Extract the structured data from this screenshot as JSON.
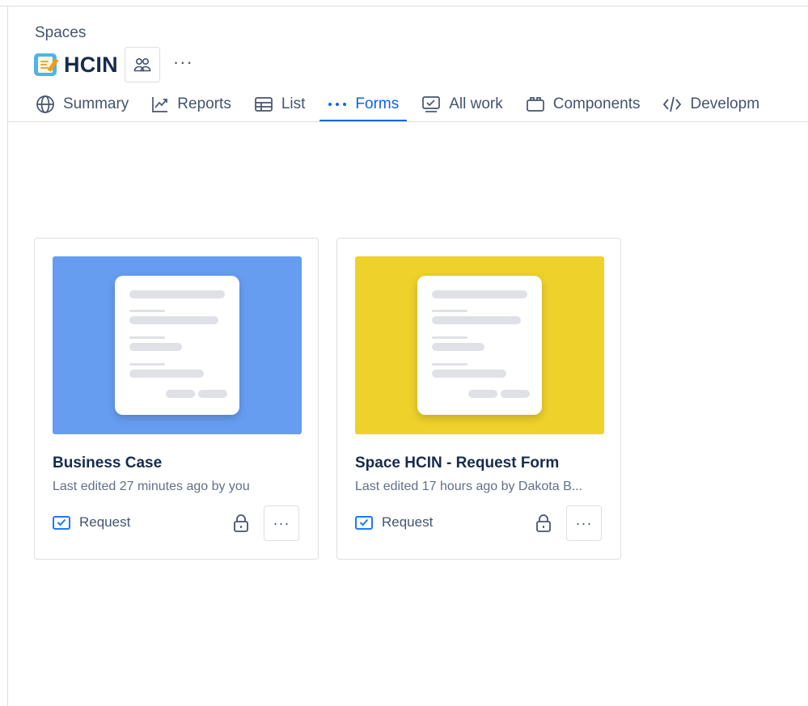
{
  "breadcrumb": "Spaces",
  "space": {
    "title": "HCIN",
    "icon": "memo-icon",
    "more_label": "···"
  },
  "tabs": [
    {
      "label": "Summary",
      "icon": "globe-icon",
      "active": false
    },
    {
      "label": "Reports",
      "icon": "line-chart-icon",
      "active": false
    },
    {
      "label": "List",
      "icon": "table-icon",
      "active": false
    },
    {
      "label": "Forms",
      "icon": "dots-icon",
      "active": true
    },
    {
      "label": "All work",
      "icon": "stacked-checklist-icon",
      "active": false
    },
    {
      "label": "Components",
      "icon": "component-icon",
      "active": false
    },
    {
      "label": "Developm",
      "icon": "code-icon",
      "active": false
    }
  ],
  "forms": [
    {
      "title": "Business Case",
      "meta": "Last edited 27 minutes ago by you",
      "type": "Request",
      "thumb_color": "#669df1",
      "more_label": "···"
    },
    {
      "title": "Space HCIN - Request Form",
      "meta": "Last edited 17 hours ago by Dakota B...",
      "type": "Request",
      "thumb_color": "#eed12b",
      "more_label": "···"
    }
  ],
  "colors": {
    "accent": "#0c66e4",
    "border": "#dcdfe4",
    "text": "#172b4d",
    "subtle": "#44546f"
  }
}
